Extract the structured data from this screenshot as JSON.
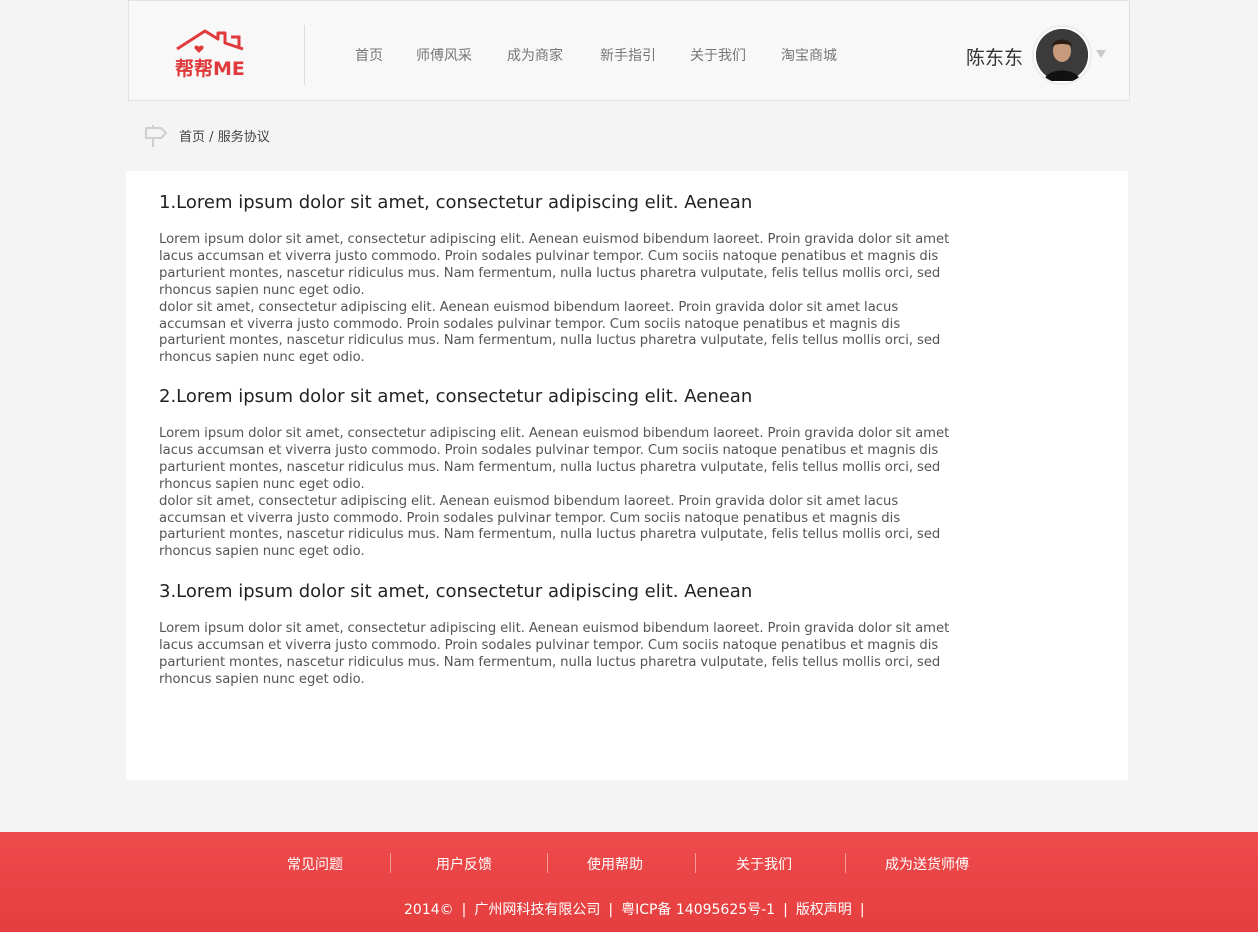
{
  "header": {
    "logo_text": "帮帮ME",
    "nav": [
      "首页",
      "师傅风采",
      "成为商家",
      "新手指引",
      "关于我们",
      "淘宝商城"
    ],
    "user_name": "陈东东"
  },
  "breadcrumb": {
    "home": "首页",
    "separator": "/",
    "current": "服务协议"
  },
  "sections": [
    {
      "title": "1.Lorem ipsum dolor sit amet, consectetur adipiscing elit. Aenean",
      "paragraphs": [
        "Lorem ipsum dolor sit amet, consectetur adipiscing elit. Aenean euismod bibendum laoreet. Proin gravida dolor sit amet lacus accumsan et viverra justo commodo. Proin sodales pulvinar tempor. Cum sociis natoque penatibus et magnis dis parturient montes, nascetur ridiculus mus. Nam fermentum, nulla luctus pharetra vulputate, felis tellus mollis orci, sed rhoncus sapien nunc eget odio.",
        " dolor sit amet, consectetur adipiscing elit. Aenean euismod bibendum laoreet. Proin gravida dolor sit amet lacus accumsan et viverra justo commodo. Proin sodales pulvinar tempor. Cum sociis natoque penatibus et magnis dis parturient montes, nascetur ridiculus mus. Nam fermentum, nulla luctus pharetra vulputate, felis tellus mollis orci, sed rhoncus sapien nunc eget odio."
      ]
    },
    {
      "title": "2.Lorem ipsum dolor sit amet, consectetur adipiscing elit. Aenean",
      "paragraphs": [
        "Lorem ipsum dolor sit amet, consectetur adipiscing elit. Aenean euismod bibendum laoreet. Proin gravida dolor sit amet lacus accumsan et viverra justo commodo. Proin sodales pulvinar tempor. Cum sociis natoque penatibus et magnis dis parturient montes, nascetur ridiculus mus. Nam fermentum, nulla luctus pharetra vulputate, felis tellus mollis orci, sed rhoncus sapien nunc eget odio.",
        " dolor sit amet, consectetur adipiscing elit. Aenean euismod bibendum laoreet. Proin gravida dolor sit amet lacus accumsan et viverra justo commodo. Proin sodales pulvinar tempor. Cum sociis natoque penatibus et magnis dis parturient montes, nascetur ridiculus mus. Nam fermentum, nulla luctus pharetra vulputate, felis tellus mollis orci, sed rhoncus sapien nunc eget odio."
      ]
    },
    {
      "title": "3.Lorem ipsum dolor sit amet, consectetur adipiscing elit. Aenean",
      "paragraphs": [
        "Lorem ipsum dolor sit amet, consectetur adipiscing elit. Aenean euismod bibendum laoreet. Proin gravida dolor sit amet lacus accumsan et viverra justo commodo. Proin sodales pulvinar tempor. Cum sociis natoque penatibus et magnis dis parturient montes, nascetur ridiculus mus. Nam fermentum, nulla luctus pharetra vulputate, felis tellus mollis orci, sed rhoncus sapien nunc eget odio."
      ]
    }
  ],
  "footer": {
    "links": [
      "常见问题",
      "用户反馈",
      "使用帮助",
      "关于我们",
      "成为送货师傅"
    ],
    "copyright": [
      "2014©",
      "广州网科技有限公司",
      "粤ICP备 14095625号-1",
      "版权声明"
    ],
    "separator": "|"
  },
  "colors": {
    "brand_red": "#e53e3f",
    "logo_red": "#e03a3c"
  }
}
